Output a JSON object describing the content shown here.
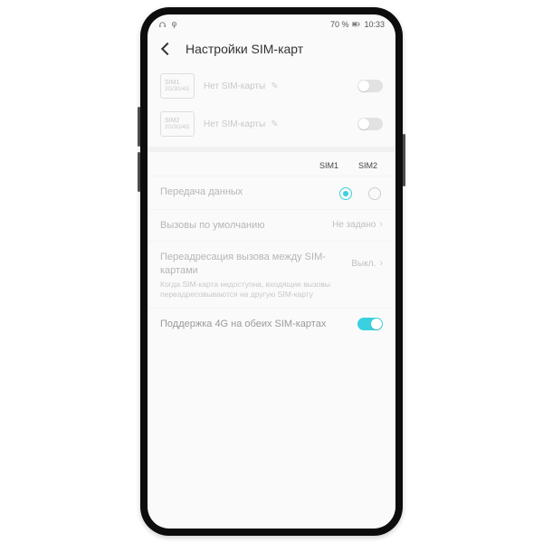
{
  "status": {
    "battery": "70 %",
    "time": "10:33"
  },
  "header": {
    "title": "Настройки SIM-карт"
  },
  "sims": [
    {
      "name": "SIM1",
      "mode": "2G/3G/4G",
      "status": "Нет SIM-карты"
    },
    {
      "name": "SIM2",
      "mode": "2G/3G/4G",
      "status": "Нет SIM-карты"
    }
  ],
  "cols": {
    "a": "SIM1",
    "b": "SIM2"
  },
  "rows": {
    "data": {
      "label": "Передача данных"
    },
    "calls": {
      "label": "Вызовы по умолчанию",
      "value": "Не задано"
    },
    "fwd": {
      "label": "Переадресация вызова между SIM-картами",
      "sub": "Когда SIM-карта недоступна, входящие вызовы переадресовываются на другую SIM-карту",
      "value": "Выкл."
    },
    "dual4g": {
      "label": "Поддержка 4G на обеих SIM-картах"
    }
  }
}
